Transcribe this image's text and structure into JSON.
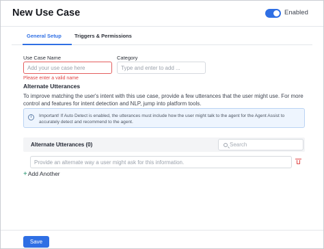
{
  "header": {
    "title": "New Use Case",
    "toggle_label": "Enabled",
    "toggle_on": true
  },
  "tabs": [
    {
      "label": "General Setup",
      "active": true
    },
    {
      "label": "Triggers & Permissions",
      "active": false
    }
  ],
  "form": {
    "use_case_name": {
      "label": "Use Case Name",
      "placeholder": "Add your use case here",
      "value": "",
      "error": "Please enter a valid name"
    },
    "category": {
      "label": "Category",
      "placeholder": "Type and enter to add ...",
      "value": ""
    }
  },
  "alternate_utterances": {
    "section_title": "Alternate Utterances",
    "description": "To improve matching the user's intent with this use case, provide a few utterances that the user might use. For more control and features for intent detection and NLP, jump into platform tools.",
    "info": "Important! If Auto Detect is enabled, the utterances must include how the user might talk to the agent for the Agent Assist to accurately detect and recommend to the agent.",
    "list_title": "Alternate Utterances (0)",
    "search_placeholder": "Search",
    "utterance_placeholder": "Provide an alternate way a user might ask for this information.",
    "add_another": "Add Another"
  },
  "footer": {
    "save_label": "Save"
  },
  "colors": {
    "accent": "#2f6fe4",
    "error": "#e04545",
    "info_bg": "#eef5fe"
  },
  "icons": {
    "info": "info-icon",
    "search": "search-icon",
    "delete": "trash-icon",
    "add": "plus-icon"
  }
}
